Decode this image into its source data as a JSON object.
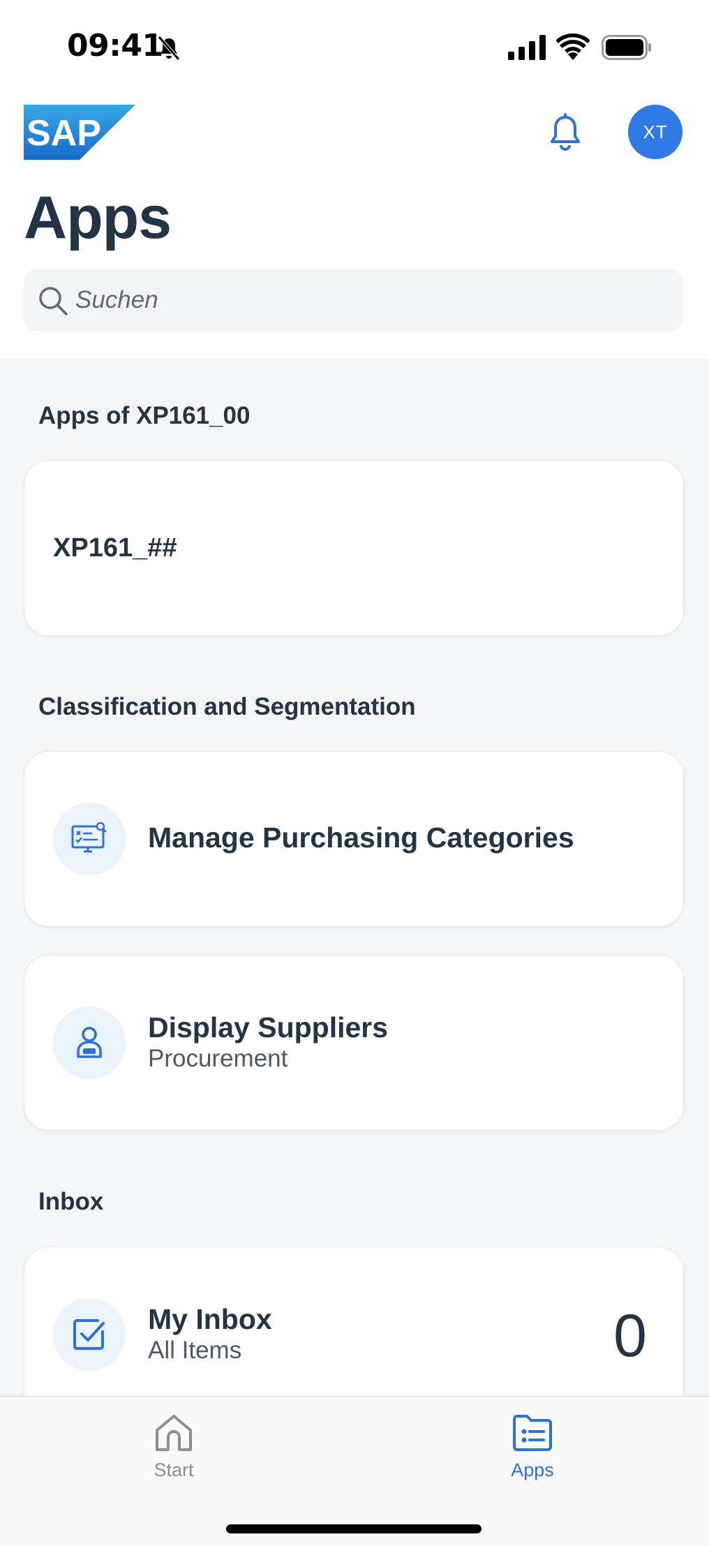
{
  "status_bar": {
    "time": "09:41"
  },
  "header": {
    "logo_text": "SAP",
    "avatar_initials": "XT",
    "title": "Apps"
  },
  "search": {
    "placeholder": "Suchen"
  },
  "sections": [
    {
      "title": "Apps of XP161_00",
      "tiles": [
        {
          "title": "XP161_##"
        }
      ]
    },
    {
      "title": "Classification and Segmentation",
      "tiles": [
        {
          "title": "Manage Purchasing Categories",
          "icon": "purchasing-categories-icon"
        },
        {
          "title": "Display Suppliers",
          "subtitle": "Procurement",
          "icon": "supplier-person-icon"
        }
      ]
    },
    {
      "title": "Inbox",
      "tiles": [
        {
          "title": "My Inbox",
          "subtitle": "All Items",
          "count": "0",
          "icon": "checkbox-task-icon"
        }
      ]
    }
  ],
  "tabbar": {
    "tabs": [
      {
        "label": "Start",
        "icon": "home-icon"
      },
      {
        "label": "Apps",
        "icon": "apps-list-icon",
        "active": true
      }
    ]
  },
  "colors": {
    "accent": "#2f6fd8",
    "avatar": "#2f7ae6",
    "text": "#223548",
    "background": "#f4f5f7"
  }
}
